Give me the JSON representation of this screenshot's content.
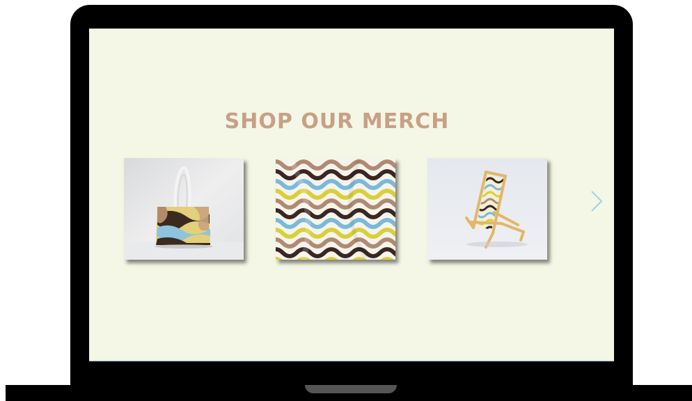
{
  "merch_section": {
    "title": "SHOP OUR MERCH",
    "products": [
      {
        "icon": "tote-bag-image"
      },
      {
        "icon": "wavy-fabric-image"
      },
      {
        "icon": "beach-chair-image"
      }
    ],
    "next_icon": "chevron-right-icon"
  },
  "colors": {
    "screen_background": "#f4f7e5",
    "title_color": "#c8a086",
    "arrow_color": "#9fd3e6",
    "wave_tan": "#b08a72",
    "wave_brown": "#3a2622",
    "wave_blue": "#7bb9dc",
    "wave_yellow": "#d9cf3a"
  }
}
